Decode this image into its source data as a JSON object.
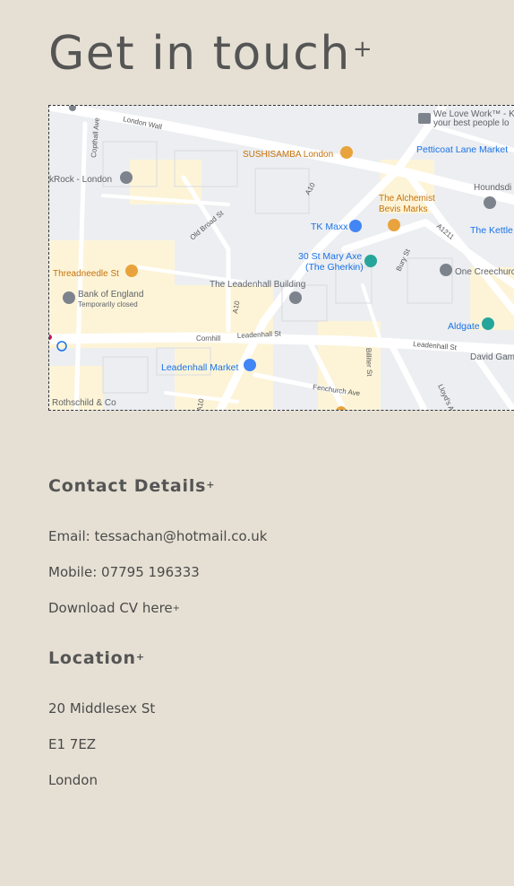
{
  "page": {
    "title": "Get in touch",
    "title_suffix": "+"
  },
  "map": {
    "roads": {
      "london_wall": "London Wall",
      "copthall": "Copthall Ave",
      "old_broad": "Old Broad St",
      "a10_1": "A10",
      "a10_2": "A10",
      "a10_3": "A10",
      "a1211": "A1211",
      "bury": "Bury St",
      "cornhill": "Cornhill",
      "leadenhall_1": "Leadenhall St",
      "leadenhall_2": "Leadenhall St",
      "fenchurch": "Fenchurch Ave",
      "billiter": "Billiter St",
      "lloyds": "Lloyd's Ave"
    },
    "places": {
      "we_love_work_1": "We Love Work™ - K",
      "we_love_work_2": "your best people lo",
      "sushisamba": "SUSHISAMBA London",
      "petticoat": "Petticoat Lane Market",
      "rock_london": "kRock - London",
      "houndsditch": "Houndsdi",
      "alchemist_1": "The Alchemist",
      "alchemist_2": "Bevis Marks",
      "tk_maxx": "TK Maxx",
      "kettle": "The Kettle",
      "threadneedle": "Threadneedle St",
      "gherkin_1": "30 St Mary Axe",
      "gherkin_2": "(The Gherkin)",
      "one_creechurch": "One Creechurc",
      "bank_1": "Bank of England",
      "bank_2": "Temporarily closed",
      "leadenhall_building": "The Leadenhall Building",
      "aldgate": "Aldgate",
      "david_game": "David Gam",
      "leadenhall_market": "Leadenhall Market",
      "rothschild": "Rothschild & Co"
    }
  },
  "contact": {
    "heading": "Contact Details",
    "heading_suffix": "+",
    "email_label": "Email: ",
    "email": "tessachan@hotmail.co.uk",
    "mobile_label": "Mobile: ",
    "mobile": "07795 196333",
    "cv_link": "Download CV here",
    "cv_suffix": "+"
  },
  "location": {
    "heading": "Location",
    "heading_suffix": "+",
    "line1": "20 Middlesex St",
    "line2": "E1 7EZ",
    "line3": "London"
  },
  "colors": {
    "background": "#e6e0d4",
    "text": "#4f4f4f",
    "map_orange": "#e8a33d",
    "map_blue": "#4285f4",
    "map_teal": "#26a69a",
    "map_grey": "#7d838c"
  }
}
